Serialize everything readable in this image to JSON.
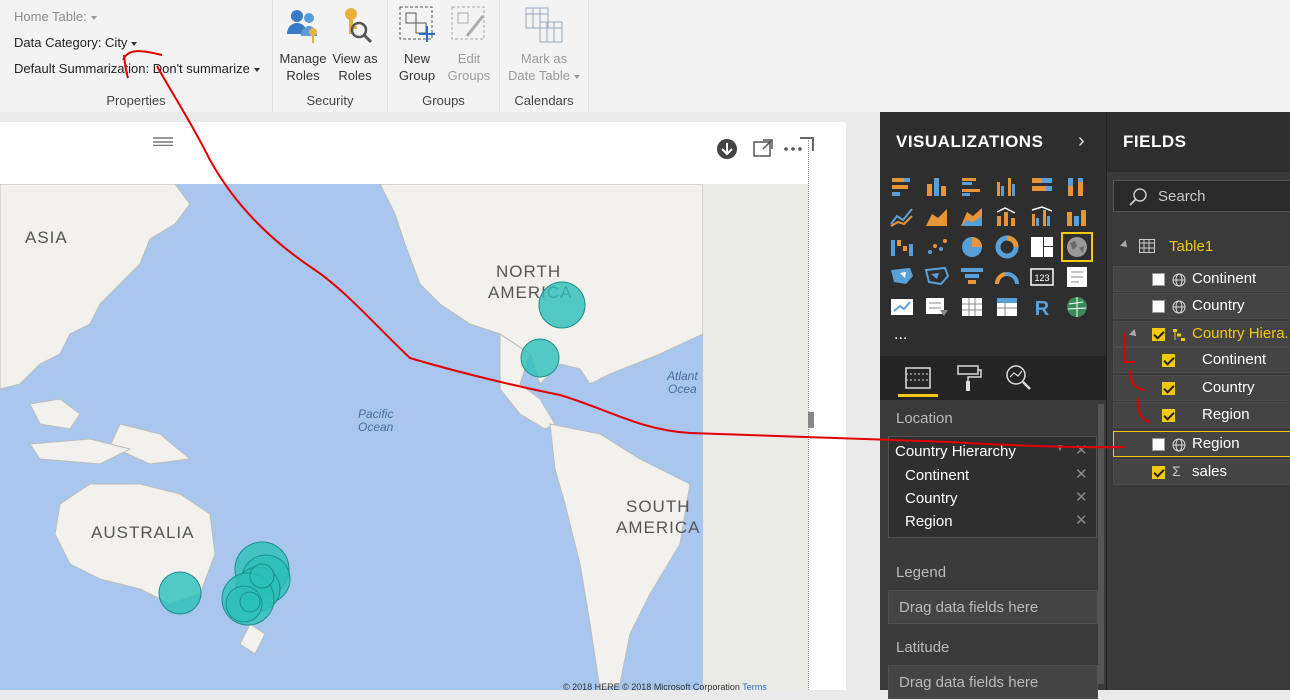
{
  "ribbon": {
    "properties": {
      "home_table_label": "Home Table:",
      "data_category_label": "Data Category: City",
      "default_summarization_label": "Default Summarization: Don't summarize",
      "group_label": "Properties"
    },
    "security": {
      "manage_roles_line1": "Manage",
      "manage_roles_line2": "Roles",
      "view_as_roles_line1": "View as",
      "view_as_roles_line2": "Roles",
      "group_label": "Security"
    },
    "groups": {
      "new_group_line1": "New",
      "new_group_line2": "Group",
      "edit_groups_line1": "Edit",
      "edit_groups_line2": "Groups",
      "group_label": "Groups"
    },
    "calendars": {
      "mark_date_table_line1": "Mark as",
      "mark_date_table_line2": "Date Table",
      "group_label": "Calendars"
    }
  },
  "map": {
    "continent_labels": {
      "asia": "ASIA",
      "north_america_1": "NORTH",
      "north_america_2": "AMERICA",
      "south_america_1": "SOUTH",
      "south_america_2": "AMERICA",
      "australia": "AUSTRALIA"
    },
    "ocean_labels": {
      "pacific_1": "Pacific",
      "pacific_2": "Ocean",
      "atlantic_1": "Atlant",
      "atlantic_2": "Ocea"
    },
    "copyright": "© 2018 HERE © 2018 Microsoft Corporation",
    "terms": "Terms",
    "bubble_color": "#2bbfb8"
  },
  "visualizations": {
    "title": "VISUALIZATIONS",
    "more": "...",
    "wells": {
      "location_label": "Location",
      "location_field": "Country Hierarchy",
      "location_items": [
        "Continent",
        "Country",
        "Region"
      ],
      "legend_label": "Legend",
      "legend_placeholder": "Drag data fields here",
      "latitude_label": "Latitude",
      "latitude_placeholder": "Drag data fields here"
    }
  },
  "fields": {
    "title": "FIELDS",
    "search_placeholder": "Search",
    "table_name": "Table1",
    "items": [
      {
        "label": "Continent",
        "checked": false
      },
      {
        "label": "Country",
        "checked": false
      },
      {
        "label": "Country Hiera...",
        "checked": true
      },
      {
        "label": "Continent",
        "checked": true
      },
      {
        "label": "Country",
        "checked": true
      },
      {
        "label": "Region",
        "checked": true
      },
      {
        "label": "Region",
        "checked": false
      },
      {
        "label": "sales",
        "checked": true
      }
    ]
  },
  "colors": {
    "accent": "#f2c811",
    "annotation": "#e00000",
    "pane_dark": "#2e2e2e"
  }
}
